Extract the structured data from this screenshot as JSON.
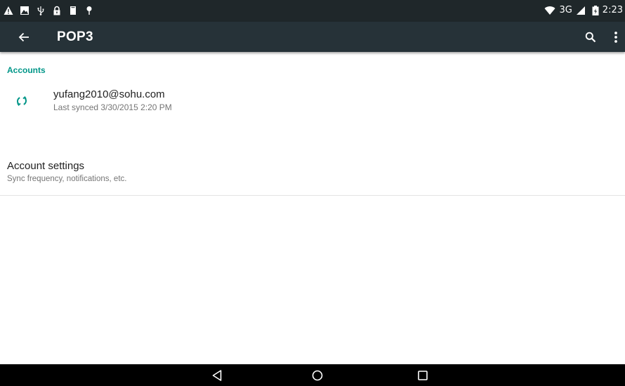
{
  "status_bar": {
    "left_icons": [
      "warning-icon",
      "image-notification-icon",
      "usb-icon",
      "lock-icon",
      "sd-card-icon",
      "location-pin-icon"
    ],
    "network_type": "3G",
    "time": "2:23",
    "right_icons": [
      "wifi-icon",
      "signal-icon",
      "battery-icon"
    ]
  },
  "action_bar": {
    "title": "POP3",
    "background": "#263238"
  },
  "accounts_section": {
    "header": "Accounts",
    "header_color": "#009688",
    "account": {
      "email": "yufang2010@sohu.com",
      "last_synced": "Last synced 3/30/2015 2:20 PM",
      "icon": "sync-icon"
    }
  },
  "settings": {
    "title": "Account settings",
    "subtitle": "Sync frequency, notifications, etc."
  },
  "nav_bar": {
    "buttons": [
      "back-nav-icon",
      "home-nav-icon",
      "recents-nav-icon"
    ]
  }
}
